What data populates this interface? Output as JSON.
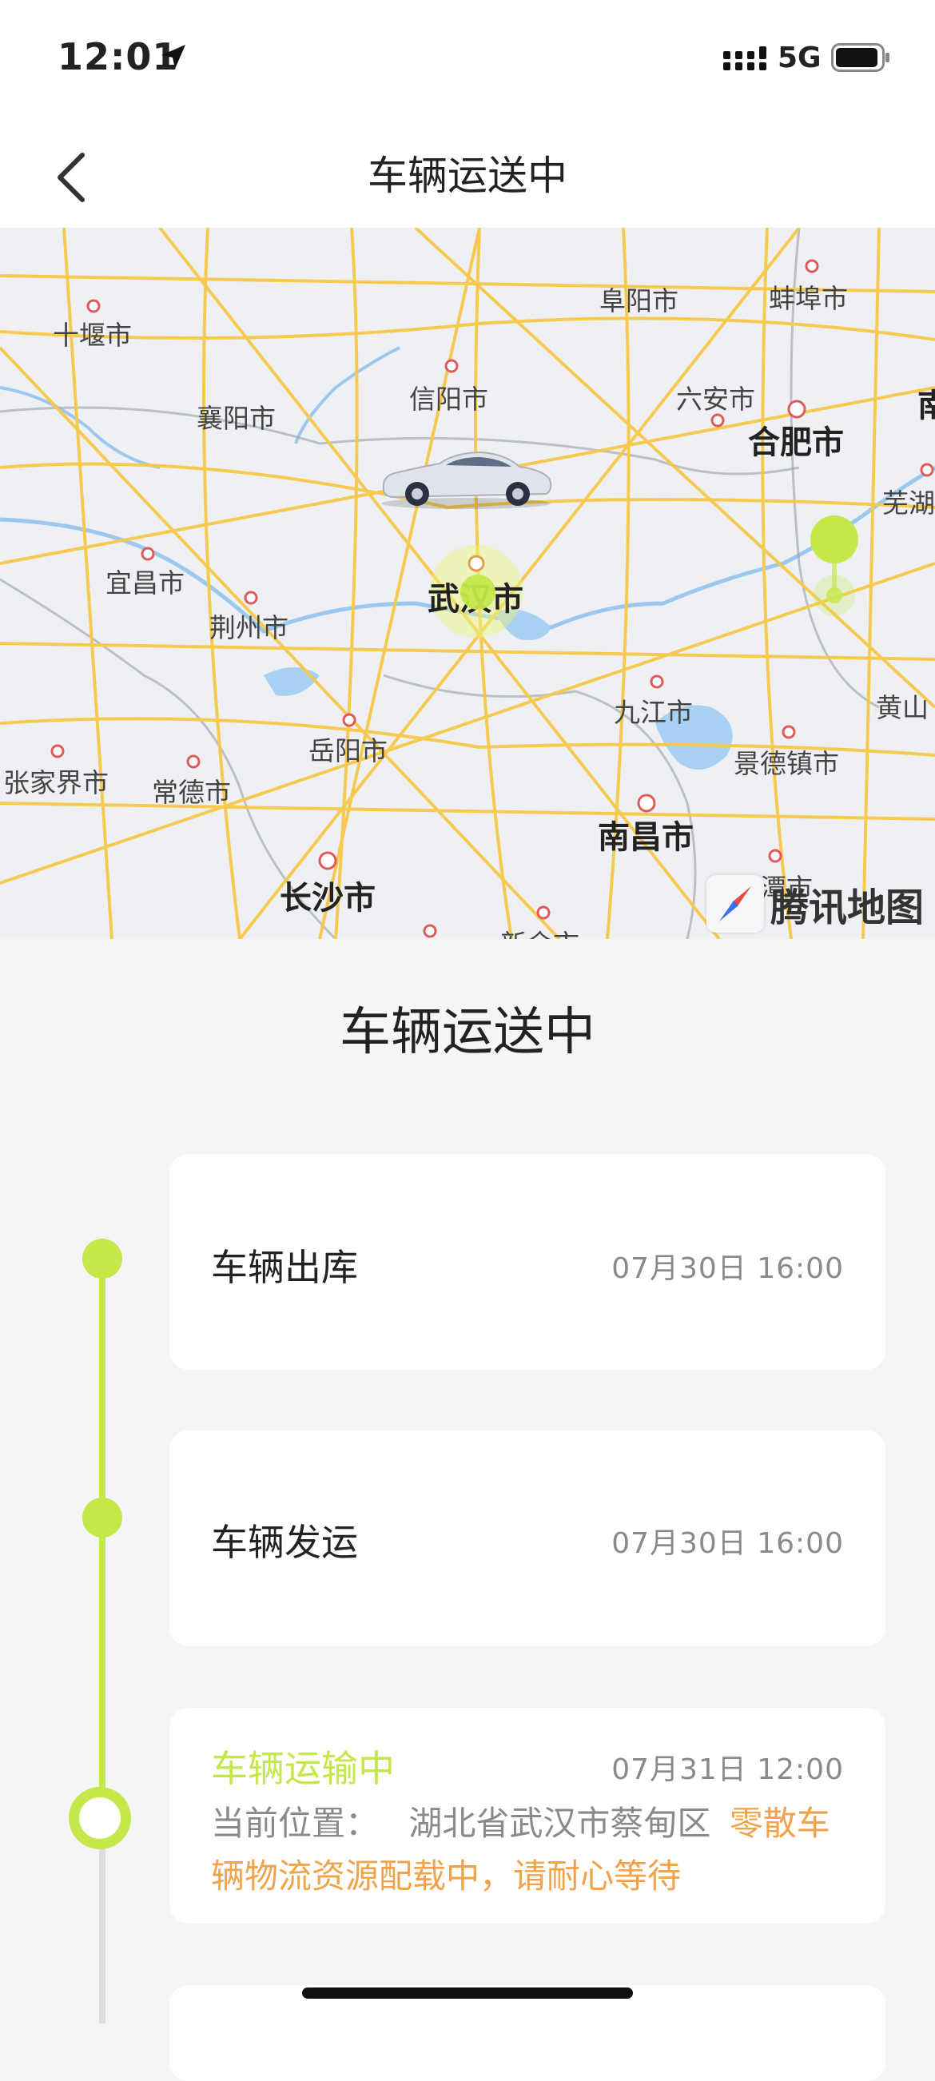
{
  "status_bar": {
    "time": "12:01",
    "network": "5G",
    "icons": [
      "location-arrow-icon",
      "signal-icon",
      "battery-icon"
    ]
  },
  "nav": {
    "title": "车辆运送中",
    "back_icon": "chevron-left-icon"
  },
  "map": {
    "cities": [
      {
        "name": "十堰市",
        "big": false
      },
      {
        "name": "阜阳市",
        "big": false
      },
      {
        "name": "蚌埠市",
        "big": false
      },
      {
        "name": "信阳市",
        "big": false
      },
      {
        "name": "襄阳市",
        "big": false
      },
      {
        "name": "六安市",
        "big": false
      },
      {
        "name": "合肥市",
        "big": true
      },
      {
        "name": "芜湖",
        "big": false
      },
      {
        "name": "宜昌市",
        "big": false
      },
      {
        "name": "武汉市",
        "big": true
      },
      {
        "name": "荆州市",
        "big": false
      },
      {
        "name": "九江市",
        "big": false
      },
      {
        "name": "黄山",
        "big": false
      },
      {
        "name": "岳阳市",
        "big": false
      },
      {
        "name": "张家界市",
        "big": false
      },
      {
        "name": "常德市",
        "big": false
      },
      {
        "name": "景德镇市",
        "big": false
      },
      {
        "name": "南昌市",
        "big": true
      },
      {
        "name": "长沙市",
        "big": true
      },
      {
        "name": "鹰潭市",
        "big": false
      },
      {
        "name": "新余市",
        "big": false
      },
      {
        "name": "南",
        "big": true
      }
    ],
    "brand": "腾讯地图",
    "markers": [
      "car-icon",
      "destination-pin-icon",
      "origin-dot-icon"
    ],
    "colors": {
      "road": "#f7c948",
      "water": "#9cc8f0",
      "accent": "#c4e74a"
    }
  },
  "section": {
    "title": "车辆运送中"
  },
  "timeline": [
    {
      "title": "车辆出库",
      "time": "07月30日 16:00",
      "active": false
    },
    {
      "title": "车辆发运",
      "time": "07月30日 16:00",
      "active": false
    },
    {
      "title": "车辆运输中",
      "time": "07月31日 12:00",
      "active": true,
      "location_label": "当前位置：",
      "location": "湖北省武汉市蔡甸区",
      "note": "零散车辆物流资源配载中，请耐心等待"
    }
  ],
  "colors": {
    "accent": "#c4e74a",
    "warn": "#f0a34a",
    "muted": "#8a8a8a"
  }
}
